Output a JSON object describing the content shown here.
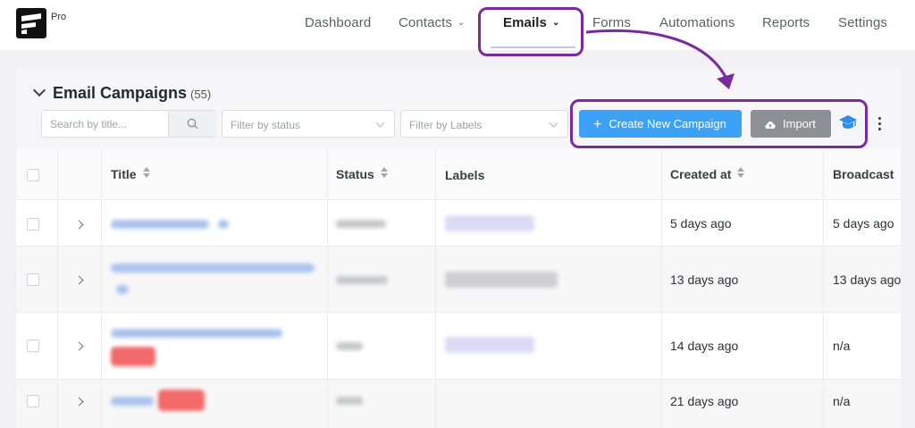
{
  "brand": {
    "logo_icon": "fluentcrm-logo-icon",
    "badge": "Pro"
  },
  "nav": {
    "items": [
      {
        "label": "Dashboard"
      },
      {
        "label": "Contacts"
      },
      {
        "label": "Emails"
      },
      {
        "label": "Forms"
      },
      {
        "label": "Automations"
      },
      {
        "label": "Reports"
      },
      {
        "label": "Settings"
      }
    ],
    "active": "Emails"
  },
  "campaigns": {
    "title": "Email Campaigns",
    "count": "(55)",
    "search": {
      "placeholder": "Search by title...",
      "value": ""
    },
    "filter_status": {
      "placeholder": "Filter by status"
    },
    "filter_labels": {
      "placeholder": "Filter by Labels"
    },
    "create_button": "Create New Campaign",
    "import_button": "Import",
    "icons": {
      "search": "search-icon",
      "cap": "graduation-cap-icon",
      "more": "more-vertical-icon",
      "cloud": "cloud-upload-icon"
    }
  },
  "table": {
    "columns": [
      "Title",
      "Status",
      "Labels",
      "Created at",
      "Broadcast"
    ],
    "rows": [
      {
        "created_at": "5 days ago",
        "broadcast": "5 days ago"
      },
      {
        "created_at": "13 days ago",
        "broadcast": "13 days ago"
      },
      {
        "created_at": "14 days ago",
        "broadcast": "n/a"
      },
      {
        "created_at": "21 days ago",
        "broadcast": "n/a"
      }
    ]
  },
  "colors": {
    "primary": "#3da2f7",
    "import": "#8c8f94",
    "highlight": "#7b2a9e",
    "cap_icon": "#2b8ee8"
  }
}
